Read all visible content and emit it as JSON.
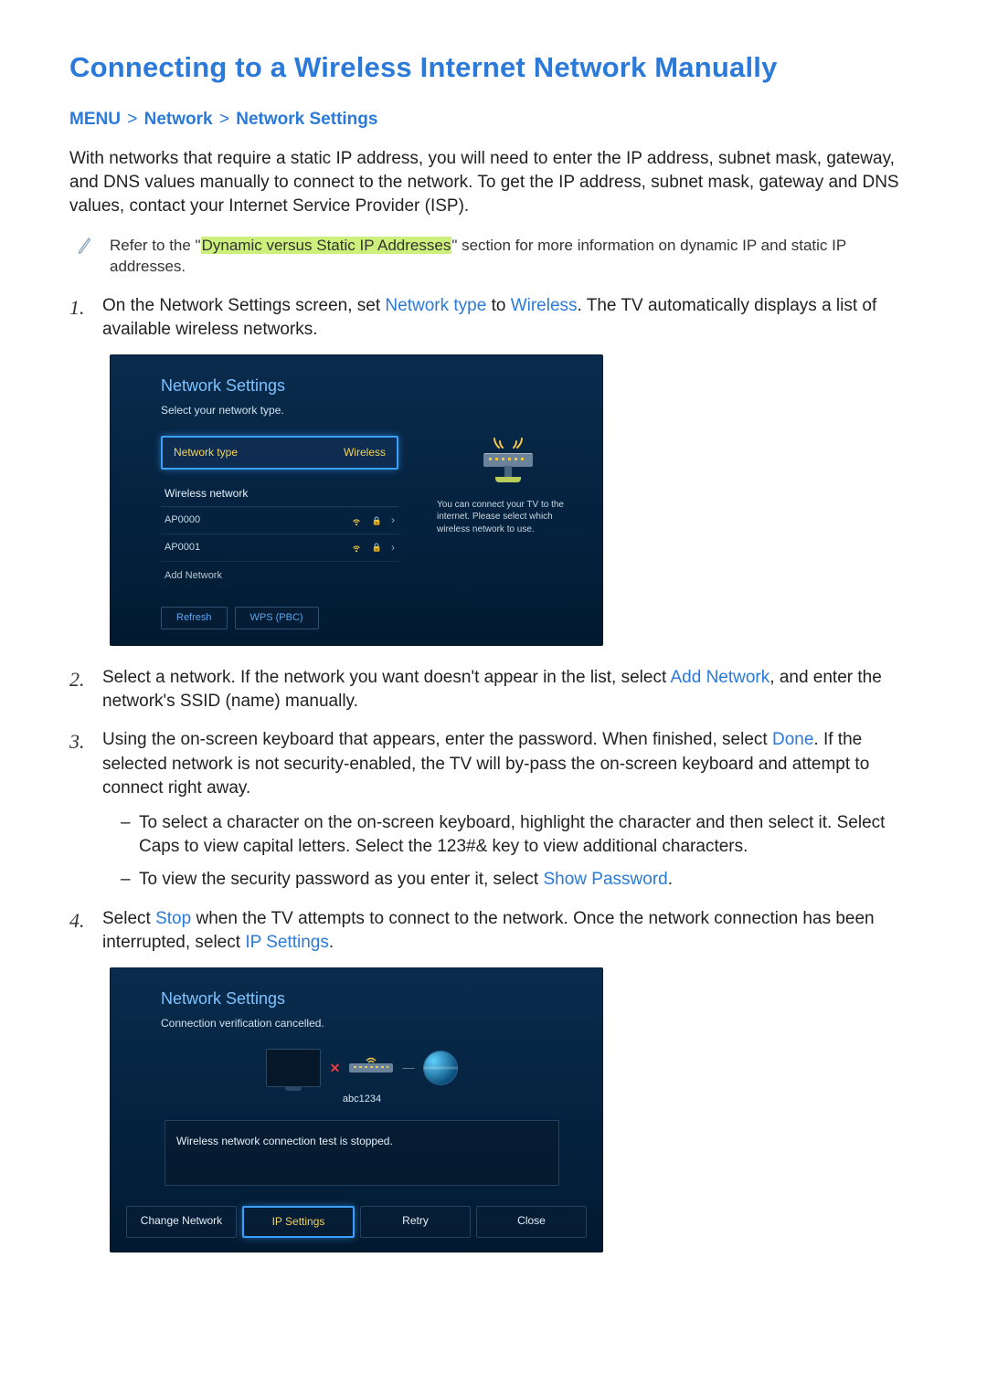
{
  "title": "Connecting to a Wireless Internet Network Manually",
  "breadcrumb": {
    "a": "MENU",
    "b": "Network",
    "c": "Network Settings"
  },
  "intro": "With networks that require a static IP address, you will need to enter the IP address, subnet mask, gateway, and DNS values manually to connect to the network. To get the IP address, subnet mask, gateway and DNS values, contact your Internet Service Provider (ISP).",
  "note": {
    "pre": "Refer to the \"",
    "link": "Dynamic versus Static IP Addresses",
    "post": "\" section for more information on dynamic IP and static IP addresses."
  },
  "steps": {
    "s1a": "On the Network Settings screen, set ",
    "s1_kw1": "Network type",
    "s1b": " to ",
    "s1_kw2": "Wireless",
    "s1c": ". The TV automatically displays a list of available wireless networks.",
    "s2a": "Select a network. If the network you want doesn't appear in the list, select ",
    "s2_kw": "Add Network",
    "s2b": ", and enter the network's SSID (name) manually.",
    "s3a": "Using the on-screen keyboard that appears, enter the password. When finished, select ",
    "s3_kw": "Done",
    "s3b": ". If the selected network is not security-enabled, the TV will by-pass the on-screen keyboard and attempt to connect right away.",
    "s3_sub1": "To select a character on the on-screen keyboard, highlight the character and then select it. Select Caps to view capital letters. Select the 123#& key to view additional characters.",
    "s3_sub2a": "To view the security password as you enter it, select ",
    "s3_sub2_kw": "Show Password",
    "s3_sub2b": ".",
    "s4a": "Select ",
    "s4_kw1": "Stop",
    "s4b": " when the TV attempts to connect to the network. Once the network connection has been interrupted, select ",
    "s4_kw2": "IP Settings",
    "s4c": "."
  },
  "shot1": {
    "title": "Network Settings",
    "subtitle": "Select your network type.",
    "ntype_label": "Network type",
    "ntype_value": "Wireless",
    "wnet_header": "Wireless network",
    "ap": [
      "AP0000",
      "AP0001"
    ],
    "add_network": "Add Network",
    "help": "You can connect your TV to the internet. Please select which wireless network to use.",
    "btn_refresh": "Refresh",
    "btn_wps": "WPS (PBC)"
  },
  "shot2": {
    "title": "Network Settings",
    "subtitle": "Connection verification cancelled.",
    "ssid": "abc1234",
    "status": "Wireless network connection test is stopped.",
    "btn_change": "Change Network",
    "btn_ip": "IP Settings",
    "btn_retry": "Retry",
    "btn_close": "Close"
  }
}
